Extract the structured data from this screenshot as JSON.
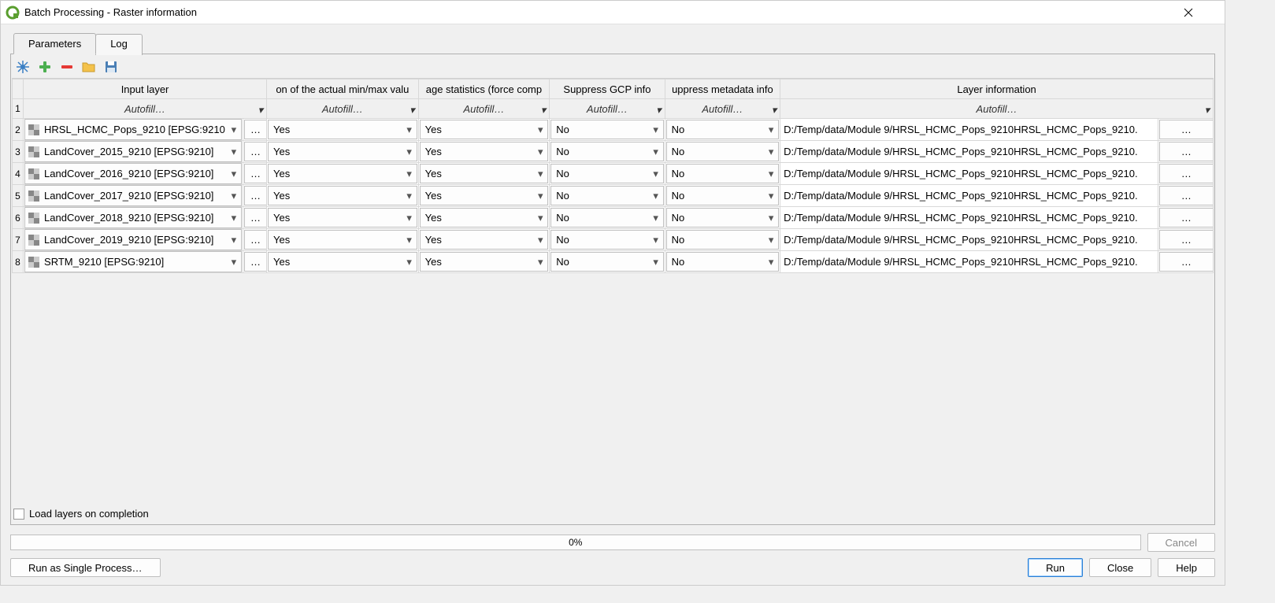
{
  "window": {
    "title": "Batch Processing - Raster information"
  },
  "tabs": {
    "parameters": "Parameters",
    "log": "Log"
  },
  "columns": {
    "input": "Input layer",
    "minmax": "on of the actual min/max valu",
    "stats": "age statistics (force comp",
    "gcp": "Suppress GCP info",
    "meta": "uppress metadata info",
    "layerinfo": "Layer information"
  },
  "autofill_label": "Autofill…",
  "rows": [
    {
      "n": "2",
      "layer": "HRSL_HCMC_Pops_9210 [EPSG:9210",
      "minmax": "Yes",
      "stats": "Yes",
      "gcp": "No",
      "meta": "No",
      "out": "D:/Temp/data/Module 9/HRSL_HCMC_Pops_9210HRSL_HCMC_Pops_9210."
    },
    {
      "n": "3",
      "layer": "LandCover_2015_9210 [EPSG:9210]",
      "minmax": "Yes",
      "stats": "Yes",
      "gcp": "No",
      "meta": "No",
      "out": "D:/Temp/data/Module 9/HRSL_HCMC_Pops_9210HRSL_HCMC_Pops_9210."
    },
    {
      "n": "4",
      "layer": "LandCover_2016_9210 [EPSG:9210]",
      "minmax": "Yes",
      "stats": "Yes",
      "gcp": "No",
      "meta": "No",
      "out": "D:/Temp/data/Module 9/HRSL_HCMC_Pops_9210HRSL_HCMC_Pops_9210."
    },
    {
      "n": "5",
      "layer": "LandCover_2017_9210 [EPSG:9210]",
      "minmax": "Yes",
      "stats": "Yes",
      "gcp": "No",
      "meta": "No",
      "out": "D:/Temp/data/Module 9/HRSL_HCMC_Pops_9210HRSL_HCMC_Pops_9210."
    },
    {
      "n": "6",
      "layer": "LandCover_2018_9210 [EPSG:9210]",
      "minmax": "Yes",
      "stats": "Yes",
      "gcp": "No",
      "meta": "No",
      "out": "D:/Temp/data/Module 9/HRSL_HCMC_Pops_9210HRSL_HCMC_Pops_9210."
    },
    {
      "n": "7",
      "layer": "LandCover_2019_9210 [EPSG:9210]",
      "minmax": "Yes",
      "stats": "Yes",
      "gcp": "No",
      "meta": "No",
      "out": "D:/Temp/data/Module 9/HRSL_HCMC_Pops_9210HRSL_HCMC_Pops_9210."
    },
    {
      "n": "8",
      "layer": "SRTM_9210 [EPSG:9210]",
      "minmax": "Yes",
      "stats": "Yes",
      "gcp": "No",
      "meta": "No",
      "out": "D:/Temp/data/Module 9/HRSL_HCMC_Pops_9210HRSL_HCMC_Pops_9210."
    }
  ],
  "autofill_header_num": "1",
  "browse_label": "…",
  "load_layers_label": "Load layers on completion",
  "progress_text": "0%",
  "buttons": {
    "cancel": "Cancel",
    "run_single": "Run as Single Process…",
    "run": "Run",
    "close": "Close",
    "help": "Help"
  }
}
